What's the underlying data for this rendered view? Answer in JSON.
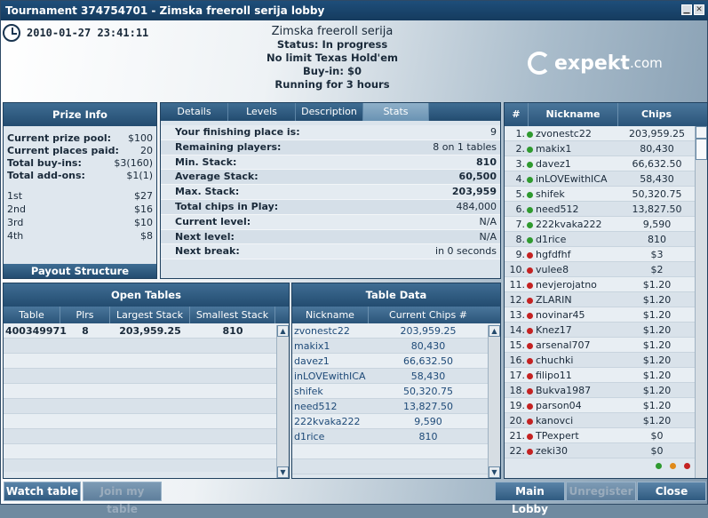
{
  "window": {
    "title": "Tournament 374754701 - Zimska freeroll serija lobby",
    "minimize_icon": "minimize-icon",
    "close_icon": "close-icon"
  },
  "datetime": "2010-01-27 23:41:11",
  "header": {
    "name": "Zimska freeroll serija",
    "status": "Status: In progress",
    "game": "No limit Texas Hold'em",
    "buyin": "Buy-in: $0",
    "running": "Running for 3 hours"
  },
  "logo": {
    "text": "expekt",
    "suffix": ".com"
  },
  "prize_info": {
    "title": "Prize Info",
    "rows": [
      {
        "label": "Current prize pool:",
        "value": "$100",
        "bold": true
      },
      {
        "label": "Current places paid:",
        "value": "20",
        "bold": true
      },
      {
        "label": "Total buy-ins:",
        "value": "$3(160)",
        "bold": true
      },
      {
        "label": "Total add-ons:",
        "value": "$1(1)",
        "bold": true
      }
    ],
    "payouts": [
      {
        "place": "1st",
        "amount": "$27"
      },
      {
        "place": "2nd",
        "amount": "$16"
      },
      {
        "place": "3rd",
        "amount": "$10"
      },
      {
        "place": "4th",
        "amount": "$8"
      }
    ],
    "footer": "Payout Structure"
  },
  "tabs": [
    "Details",
    "Levels",
    "Description",
    "Stats"
  ],
  "active_tab": "Stats",
  "stats": [
    {
      "label": "Your finishing place is:",
      "value": "9"
    },
    {
      "label": "Remaining players:",
      "value": "8 on 1 tables"
    },
    {
      "label": "Min. Stack:",
      "value": "810"
    },
    {
      "label": "Average Stack:",
      "value": "60,500"
    },
    {
      "label": "Max. Stack:",
      "value": "203,959"
    },
    {
      "label": "Total chips in Play:",
      "value": "484,000"
    },
    {
      "label": "Current level:",
      "value": "N/A"
    },
    {
      "label": "Next level:",
      "value": "N/A"
    },
    {
      "label": "Next break:",
      "value": "in 0 seconds"
    }
  ],
  "open_tables": {
    "title": "Open Tables",
    "columns": [
      "Table",
      "Plrs",
      "Largest Stack",
      "Smallest Stack"
    ],
    "rows": [
      {
        "table": "400349971",
        "plrs": "8",
        "largest": "203,959.25",
        "smallest": "810"
      }
    ]
  },
  "table_data": {
    "title": "Table Data",
    "columns": [
      "Nickname",
      "Current Chips #"
    ],
    "rows": [
      {
        "nick": "zvonestc22",
        "chips": "203,959.25"
      },
      {
        "nick": "makix1",
        "chips": "80,430"
      },
      {
        "nick": "davez1",
        "chips": "66,632.50"
      },
      {
        "nick": "inLOVEwithICA",
        "chips": "58,430"
      },
      {
        "nick": "shifek",
        "chips": "50,320.75"
      },
      {
        "nick": "need512",
        "chips": "13,827.50"
      },
      {
        "nick": "222kvaka222",
        "chips": "9,590"
      },
      {
        "nick": "d1rice",
        "chips": "810"
      }
    ]
  },
  "players": {
    "columns": [
      "#",
      "Nickname",
      "Chips"
    ],
    "rows": [
      {
        "n": "1.",
        "nick": "zvonestc22",
        "chips": "203,959.25",
        "status": "green"
      },
      {
        "n": "2.",
        "nick": "makix1",
        "chips": "80,430",
        "status": "green"
      },
      {
        "n": "3.",
        "nick": "davez1",
        "chips": "66,632.50",
        "status": "green"
      },
      {
        "n": "4.",
        "nick": "inLOVEwithICA",
        "chips": "58,430",
        "status": "green"
      },
      {
        "n": "5.",
        "nick": "shifek",
        "chips": "50,320.75",
        "status": "green"
      },
      {
        "n": "6.",
        "nick": "need512",
        "chips": "13,827.50",
        "status": "green"
      },
      {
        "n": "7.",
        "nick": "222kvaka222",
        "chips": "9,590",
        "status": "green"
      },
      {
        "n": "8.",
        "nick": "d1rice",
        "chips": "810",
        "status": "green"
      },
      {
        "n": "9.",
        "nick": "hgfdfhf",
        "chips": "$3",
        "status": "red"
      },
      {
        "n": "10.",
        "nick": "vulee8",
        "chips": "$2",
        "status": "red"
      },
      {
        "n": "11.",
        "nick": "nevjerojatno",
        "chips": "$1.20",
        "status": "red"
      },
      {
        "n": "12.",
        "nick": "ZLARIN",
        "chips": "$1.20",
        "status": "red"
      },
      {
        "n": "13.",
        "nick": "novinar45",
        "chips": "$1.20",
        "status": "red"
      },
      {
        "n": "14.",
        "nick": "Knez17",
        "chips": "$1.20",
        "status": "red"
      },
      {
        "n": "15.",
        "nick": "arsenal707",
        "chips": "$1.20",
        "status": "red"
      },
      {
        "n": "16.",
        "nick": "chuchki",
        "chips": "$1.20",
        "status": "red"
      },
      {
        "n": "17.",
        "nick": "filipo11",
        "chips": "$1.20",
        "status": "red"
      },
      {
        "n": "18.",
        "nick": "Bukva1987",
        "chips": "$1.20",
        "status": "red"
      },
      {
        "n": "19.",
        "nick": "parson04",
        "chips": "$1.20",
        "status": "red"
      },
      {
        "n": "20.",
        "nick": "kanovci",
        "chips": "$1.20",
        "status": "red"
      },
      {
        "n": "21.",
        "nick": "TPexpert",
        "chips": "$0",
        "status": "red"
      },
      {
        "n": "22.",
        "nick": "zeki30",
        "chips": "$0",
        "status": "red"
      }
    ]
  },
  "colors": {
    "green": "#2f9a2f",
    "red": "#c42222",
    "orange": "#e08a1a"
  },
  "buttons": {
    "watch": "Watch table",
    "join": "Join my table",
    "main": "Main Lobby",
    "unregister": "Unregister",
    "close": "Close"
  }
}
